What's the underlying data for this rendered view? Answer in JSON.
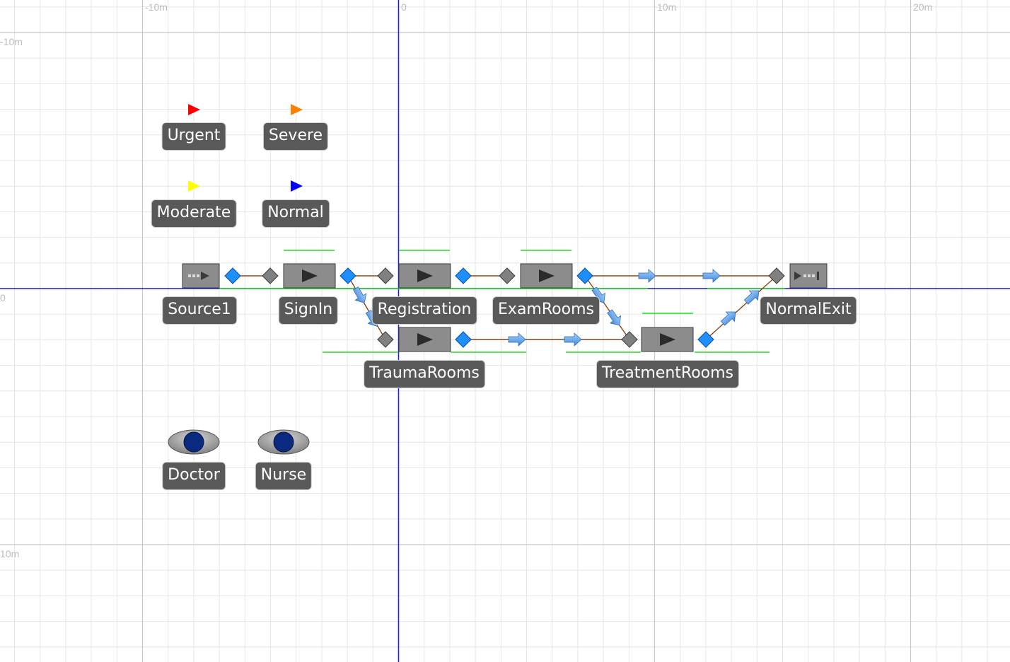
{
  "rulers": {
    "x_labels": [
      "-10m",
      "0",
      "10m",
      "20m"
    ],
    "y_labels": [
      "-10m",
      "0",
      "10m"
    ]
  },
  "legend_entities": [
    {
      "label": "Urgent",
      "color": "#ff0000"
    },
    {
      "label": "Severe",
      "color": "#ff8000"
    },
    {
      "label": "Moderate",
      "color": "#ffff00"
    },
    {
      "label": "Normal",
      "color": "#0000ff"
    }
  ],
  "nodes": {
    "source": "Source1",
    "signin": "SignIn",
    "registration": "Registration",
    "exam": "ExamRooms",
    "trauma": "TraumaRooms",
    "treatment": "TreatmentRooms",
    "exit": "NormalExit"
  },
  "workers": [
    {
      "label": "Doctor",
      "color": "#0a2a80"
    },
    {
      "label": "Nurse",
      "color": "#0a2a80"
    }
  ],
  "colors": {
    "grid_minor": "#e6e6e6",
    "grid_major": "#c8c8c8",
    "axis": "#1f1fd6",
    "path": "#8b4513",
    "output_node": "#1e8fff",
    "input_node": "#808080",
    "status_line": "#22dd22",
    "server_box": "#8c8c8c"
  }
}
